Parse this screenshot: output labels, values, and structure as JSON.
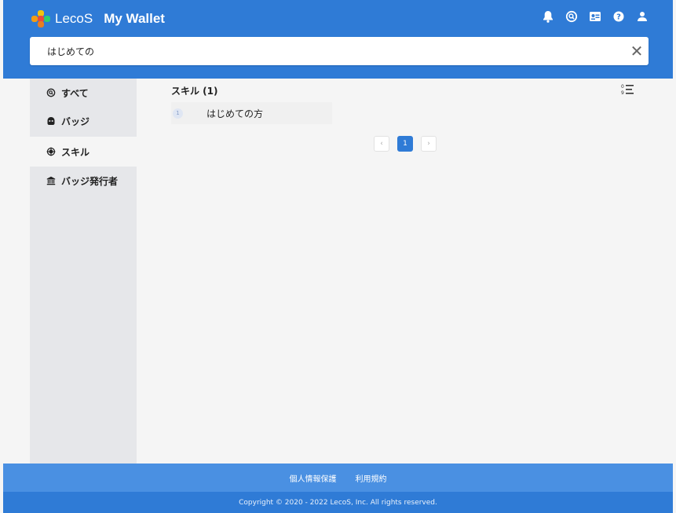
{
  "header": {
    "brand_name": "LecoS",
    "app_title": "My Wallet",
    "icons": [
      "bell-icon",
      "search-circle-icon",
      "card-icon",
      "help-icon",
      "user-icon"
    ]
  },
  "search": {
    "value": "はじめての",
    "clear_symbol": "✕"
  },
  "sidebar": {
    "items": [
      {
        "label": "すべて",
        "icon": "search-circle-icon"
      },
      {
        "label": "バッジ",
        "icon": "badge-icon"
      },
      {
        "label": "スキル",
        "icon": "skill-icon",
        "active": true
      },
      {
        "label": "バッジ発行者",
        "icon": "institution-icon"
      }
    ]
  },
  "main": {
    "section_title": "スキル (1)",
    "skills": [
      {
        "number": "1",
        "name": "はじめての方"
      }
    ],
    "pagination": {
      "prev": "‹",
      "current": "1",
      "next": "›"
    }
  },
  "footer": {
    "links": [
      "個人情報保護",
      "利用規約"
    ],
    "copyright": "Copyright © 2020 - 2022 LecoS, Inc. All rights reserved."
  },
  "colors": {
    "header_bg": "#2f7bd6",
    "footer_links_bg": "#4a90e2",
    "sidebar_bg": "#e6e7ea",
    "accent": "#2f7bd6"
  }
}
